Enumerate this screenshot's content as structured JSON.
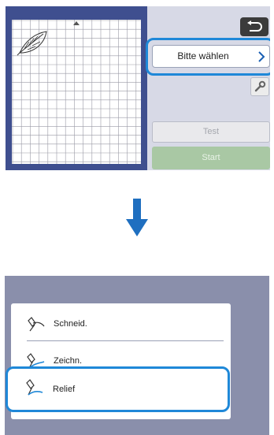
{
  "top_screen": {
    "back_icon": "return-arrow-icon",
    "pattern_selector": {
      "label": "Bitte wählen",
      "icon": "chevron-right-icon"
    },
    "settings_icon": "wrench-icon",
    "test_label": "Test",
    "start_label": "Start",
    "mat_shape_icon": "leaf-outline-icon"
  },
  "transition_icon": "arrow-down-icon",
  "bottom_screen": {
    "tool_menu": {
      "items": [
        {
          "label": "Schneid.",
          "icon": "cut-blade-icon"
        },
        {
          "label": "Zeichn.",
          "icon": "pen-icon"
        },
        {
          "label": "Relief",
          "icon": "emboss-tool-icon",
          "selected": true
        }
      ]
    }
  },
  "colors": {
    "accent": "#1f88d8",
    "screen_bg": "#d7d9e6",
    "mat_panel": "#3f4f8f",
    "start_disabled": "#a9c8a4",
    "menu_backdrop": "#8a8fab"
  }
}
